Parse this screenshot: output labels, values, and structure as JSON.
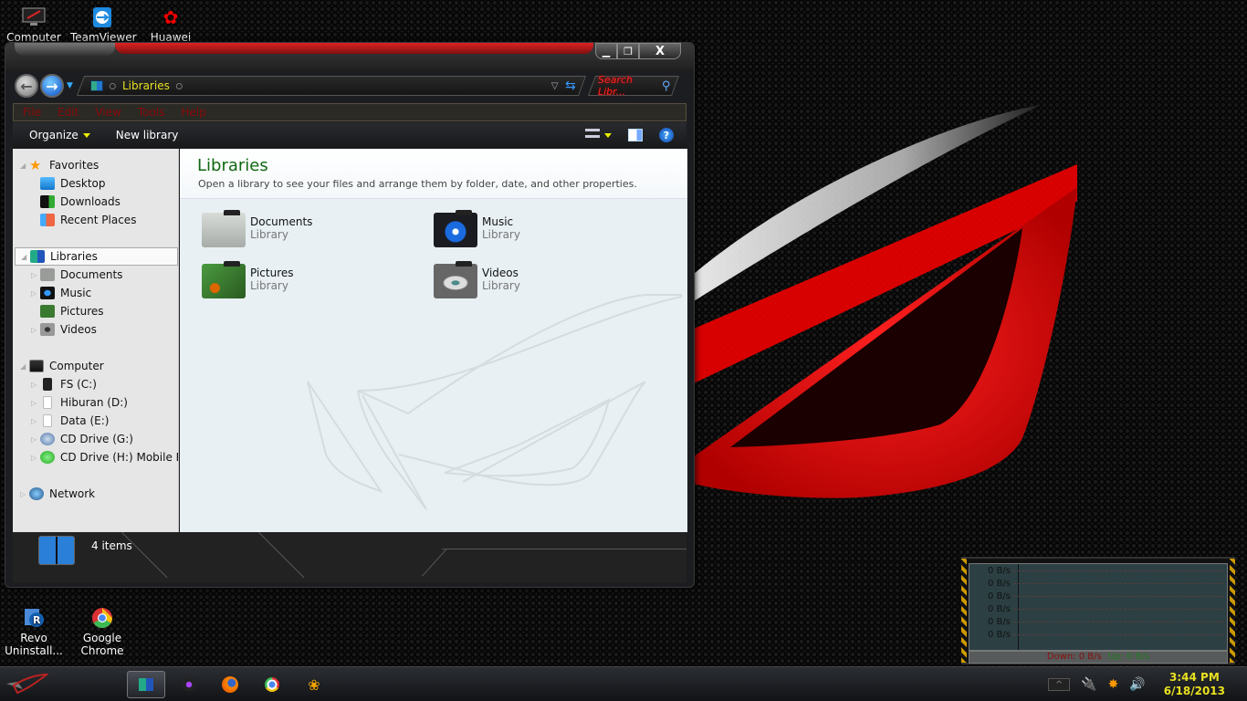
{
  "desktop": {
    "icons_top": [
      {
        "label": "Computer",
        "icon": "computer-icon"
      },
      {
        "label": "TeamViewer",
        "icon": "teamviewer-icon"
      },
      {
        "label": "Huawei",
        "icon": "huawei-icon"
      }
    ],
    "icons_bottom": [
      {
        "label_line1": "Revo",
        "label_line2": "Uninstall...",
        "icon": "revo-uninstaller-icon"
      },
      {
        "label_line1": "Google",
        "label_line2": "Chrome",
        "icon": "chrome-icon"
      }
    ]
  },
  "window": {
    "caption_buttons": {
      "minimize": "▁",
      "maximize": "❐",
      "close": "X"
    },
    "address": {
      "breadcrumb": "Libraries"
    },
    "search": {
      "placeholder": "Search Libr..."
    },
    "menu": [
      "File",
      "Edit",
      "View",
      "Tools",
      "Help"
    ],
    "commands": {
      "organize": "Organize",
      "new_library": "New library"
    },
    "nav_pane": {
      "favorites": {
        "label": "Favorites",
        "items": [
          "Desktop",
          "Downloads",
          "Recent Places"
        ]
      },
      "libraries": {
        "label": "Libraries",
        "items": [
          "Documents",
          "Music",
          "Pictures",
          "Videos"
        ]
      },
      "computer": {
        "label": "Computer",
        "items": [
          "FS (C:)",
          "Hiburan (D:)",
          "Data (E:)",
          "CD Drive (G:)",
          "CD Drive (H:) Mobile Par"
        ]
      },
      "network": {
        "label": "Network"
      }
    },
    "content": {
      "title": "Libraries",
      "subtitle": "Open a library to see your files and arrange them by folder, date, and other properties.",
      "libraries": [
        {
          "name": "Documents",
          "type": "Library",
          "color": "#c8ccc8"
        },
        {
          "name": "Music",
          "type": "Library",
          "color": "#1a1c22"
        },
        {
          "name": "Pictures",
          "type": "Library",
          "color": "#3a7a30"
        },
        {
          "name": "Videos",
          "type": "Library",
          "color": "#8a8c8c"
        }
      ]
    },
    "details": {
      "count": "4 items"
    }
  },
  "net_meter": {
    "scale_labels": [
      "0 B/s",
      "0 B/s",
      "0 B/s",
      "0 B/s",
      "0 B/s",
      "0 B/s"
    ],
    "down": "Down: 0 B/s",
    "up": "Up: 0 B/s",
    "down_color": "#8a1010",
    "up_color": "#207a20"
  },
  "taskbar": {
    "apps": [
      "windows-explorer",
      "camera-app",
      "firefox",
      "chrome",
      "network-app"
    ],
    "clock": {
      "time": "3:44 PM",
      "date": "6/18/2013"
    },
    "tray_expand": "^"
  }
}
